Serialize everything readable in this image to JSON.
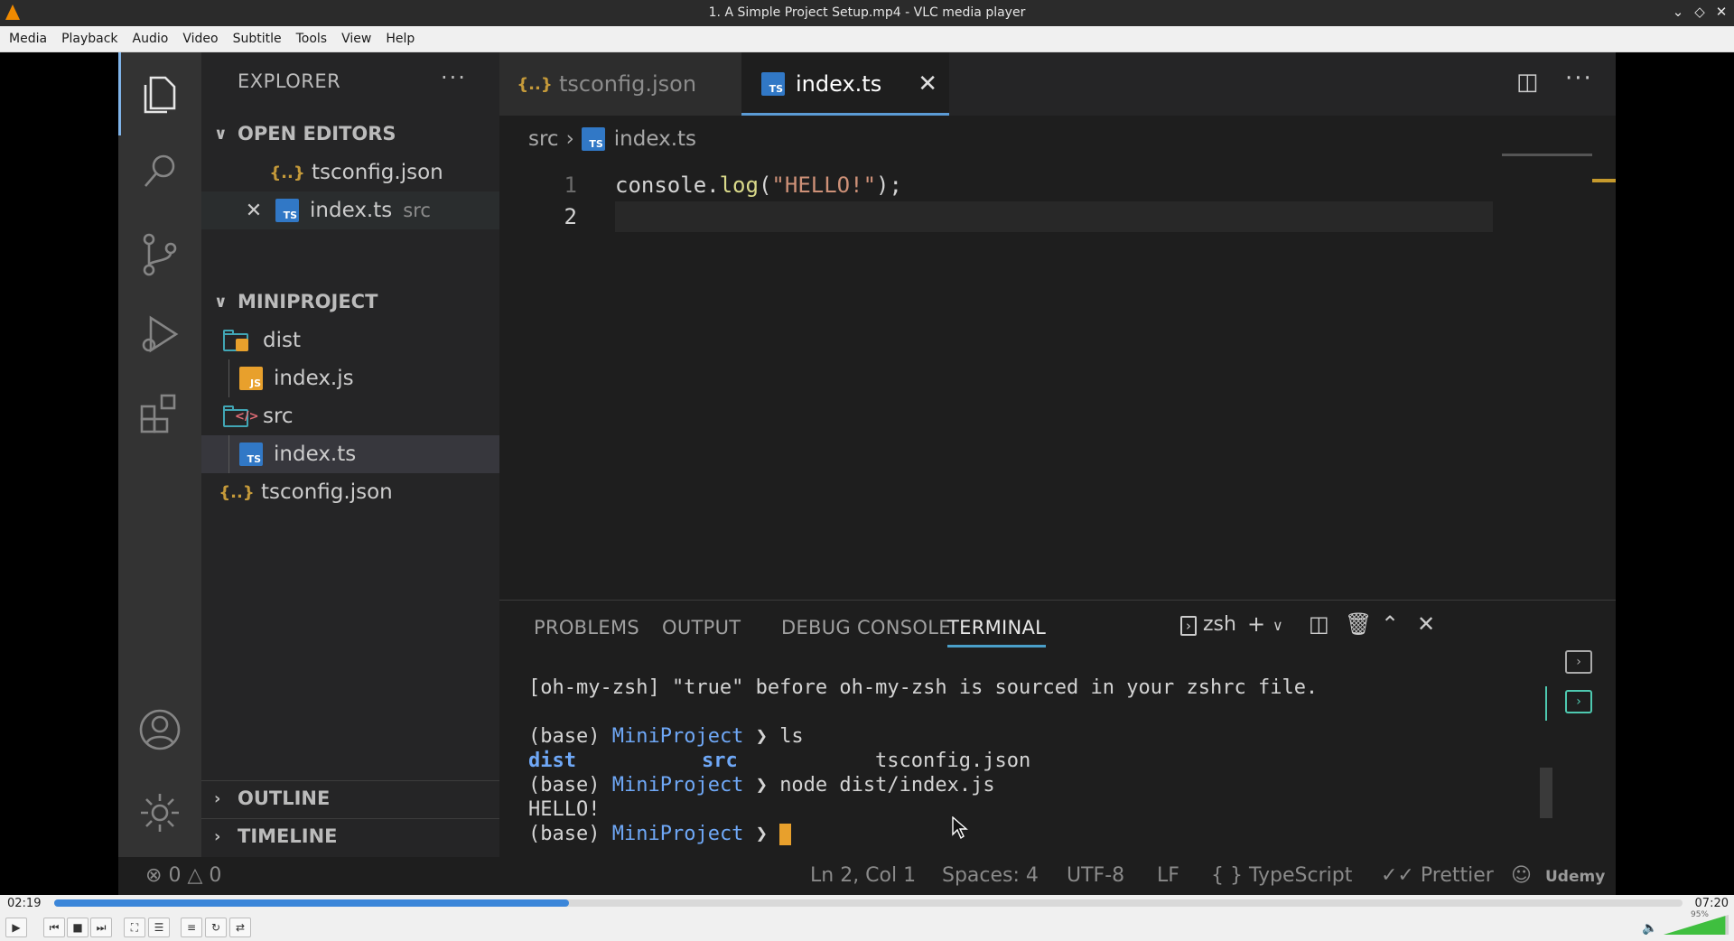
{
  "window": {
    "title": "1. A Simple Project Setup.mp4 - VLC media player"
  },
  "menu": [
    "Media",
    "Playback",
    "Audio",
    "Video",
    "Subtitle",
    "Tools",
    "View",
    "Help"
  ],
  "explorer": {
    "header": "EXPLORER",
    "open_editors": {
      "label": "OPEN EDITORS",
      "items": [
        {
          "name": "tsconfig.json",
          "detail": ""
        },
        {
          "name": "index.ts",
          "detail": "src"
        }
      ]
    },
    "project": {
      "label": "MINIPROJECT",
      "dist": "dist",
      "dist_file": "index.js",
      "src": "src",
      "src_file": "index.ts",
      "root_file": "tsconfig.json"
    },
    "outline": "OUTLINE",
    "timeline": "TIMELINE"
  },
  "tabs": [
    {
      "label": "tsconfig.json",
      "active": false
    },
    {
      "label": "index.ts",
      "active": true
    }
  ],
  "breadcrumb": {
    "folder": "src",
    "file": "index.ts"
  },
  "code": {
    "line_numbers": [
      "1",
      "2"
    ],
    "line1": {
      "obj": "console",
      "dot": ".",
      "fn": "log",
      "open": "(",
      "str": "\"HELLO!\"",
      "close": ");"
    }
  },
  "panel": {
    "tabs": [
      "PROBLEMS",
      "OUTPUT",
      "DEBUG CONSOLE",
      "TERMINAL"
    ],
    "shell": "zsh",
    "terminal": {
      "warning": "[oh-my-zsh] \"true\" before oh-my-zsh is sourced in your zshrc file.",
      "prompt_base": "(base)",
      "prompt_dir": "MiniProject",
      "prompt_arrow": "❯",
      "cmd1": "ls",
      "ls_dist": "dist",
      "ls_src": "src",
      "ls_tsconfig": "tsconfig.json",
      "cmd2": "node dist/index.js",
      "output": "HELLO!"
    }
  },
  "status": {
    "errors": "0",
    "warnings": "0",
    "position": "Ln 2, Col 1",
    "spaces": "Spaces: 4",
    "encoding": "UTF-8",
    "eol": "LF",
    "language": "TypeScript",
    "formatter": "Prettier",
    "watermark": "Udemy"
  },
  "player": {
    "elapsed": "02:19",
    "total": "07:20",
    "progress": 0.316,
    "volume_label": "95%",
    "volume": 0.95
  },
  "colors": {
    "seek_fill": "#3b86d9",
    "vlc_orange": "#f08a00"
  }
}
